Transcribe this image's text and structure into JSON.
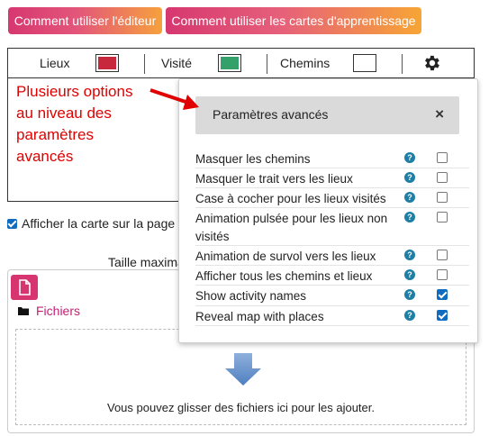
{
  "top_buttons": {
    "editor_help": "Comment utiliser l'éditeur",
    "cards_help": "Comment utiliser les cartes d'apprentissage"
  },
  "toolbar": {
    "places_label": "Lieux",
    "places_color": "#c8283c",
    "visited_label": "Visité",
    "visited_color": "#34a06a",
    "paths_label": "Chemins",
    "paths_color": "#ffffff"
  },
  "annotation": {
    "text_lines": [
      "Plusieurs options",
      "au niveau des",
      "paramètres",
      "avancés"
    ],
    "color": "#e00000"
  },
  "checkbox_show_map": {
    "label": "Afficher la carte sur la page d",
    "checked": true
  },
  "taille_label": "Taille maxima",
  "files": {
    "folder_label": "Fichiers",
    "drop_text": "Vous pouvez glisser des fichiers ici pour les ajouter."
  },
  "panel": {
    "title": "Paramètres avancés",
    "close": "×",
    "options": [
      {
        "label": "Masquer les chemins",
        "checked": false
      },
      {
        "label": "Masquer le trait vers les lieux",
        "checked": false
      },
      {
        "label": "Case à cocher pour les lieux visités",
        "checked": false
      },
      {
        "label": "Animation pulsée pour les lieux non visités",
        "checked": false
      },
      {
        "label": "Animation de survol vers les lieux",
        "checked": false
      },
      {
        "label": "Afficher tous les chemins et lieux",
        "checked": false
      },
      {
        "label": "Show activity names",
        "checked": true
      },
      {
        "label": "Reveal map with places",
        "checked": true
      }
    ],
    "help_glyph": "?"
  }
}
